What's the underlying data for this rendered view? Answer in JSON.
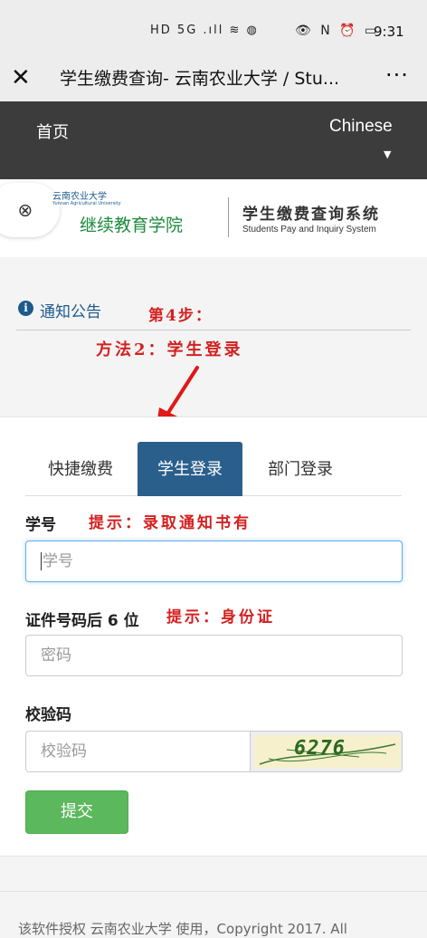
{
  "status_bar": {
    "left_icons": "HD 5G .ıll ≋ ◍",
    "right_icons": "👁 N ⏰ ▭",
    "time": "9:31"
  },
  "title_bar": {
    "close_glyph": "✕",
    "title": "学生缴费查询- 云南农业大学 / Stu...",
    "more_glyph": "···"
  },
  "nav": {
    "home": "首页",
    "language": "Chinese",
    "caret": "▼"
  },
  "header": {
    "link_glyph": "🔗",
    "university_cn": "云南农业大学",
    "university_en": "Yunnan Agricultural University",
    "college": "继续教育学院",
    "system_cn": "学生缴费查询系统",
    "system_en": "Students Pay and Inquiry System"
  },
  "notice": {
    "info_glyph": "i",
    "title": "通知公告",
    "annotation_step": "第4步：",
    "annotation_method": "方法2：学生登录"
  },
  "tabs": [
    {
      "label": "快捷缴费",
      "active": false
    },
    {
      "label": "学生登录",
      "active": true
    },
    {
      "label": "部门登录",
      "active": false
    }
  ],
  "form": {
    "student_id_label": "学号",
    "student_id_hint": "提示：录取通知书有",
    "student_id_placeholder": "学号",
    "id_last6_label": "证件号码后 6 位",
    "id_last6_hint": "提示：身份证",
    "password_placeholder": "密码",
    "captcha_label": "校验码",
    "captcha_placeholder": "校验码",
    "captcha_code": "6276",
    "submit_label": "提交"
  },
  "footer": {
    "text": "该软件授权 云南农业大学 使用，Copyright 2017. All"
  },
  "colors": {
    "nav_bg": "#3c3c3c",
    "active_tab": "#2a5f8c",
    "submit": "#5cb85c",
    "annotation": "#d42020",
    "brand_blue": "#1c5a8c",
    "brand_green": "#1c8a3c"
  }
}
